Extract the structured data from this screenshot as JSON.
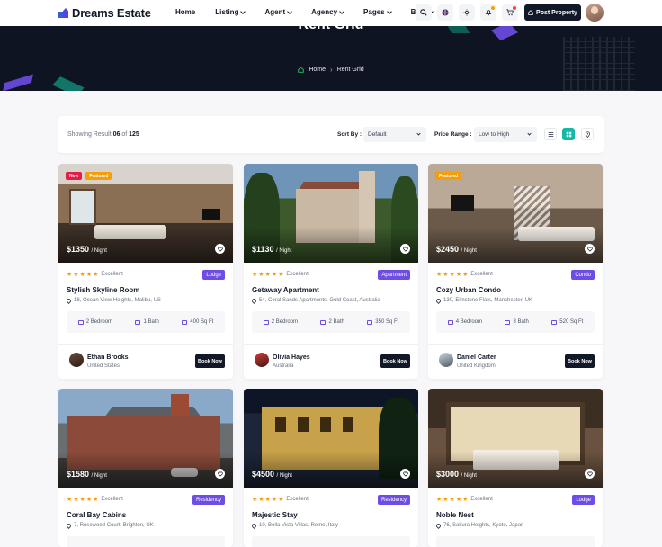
{
  "header": {
    "brand": "Dreams Estate",
    "nav": [
      {
        "label": "Home",
        "has_dropdown": false
      },
      {
        "label": "Listing",
        "has_dropdown": true
      },
      {
        "label": "Agent",
        "has_dropdown": true
      },
      {
        "label": "Agency",
        "has_dropdown": true
      },
      {
        "label": "Pages",
        "has_dropdown": true
      },
      {
        "label": "Blog",
        "has_dropdown": true
      }
    ],
    "icons": [
      "search-icon",
      "language-flag-icon",
      "theme-sun-icon",
      "notification-bell-icon",
      "cart-icon"
    ],
    "post_button": "Post Property"
  },
  "banner": {
    "title": "Rent Grid",
    "breadcrumb": [
      "Home",
      "Rent Grid"
    ]
  },
  "filter": {
    "showing_prefix": "Showing Result",
    "showing_count": "06",
    "showing_of": "of",
    "showing_total": "125",
    "sort_label": "Sort By :",
    "sort_value": "Default",
    "price_label": "Price Range :",
    "price_value": "Low to High",
    "views": [
      "list-view-icon",
      "grid-view-icon",
      "map-view-icon"
    ]
  },
  "colors": {
    "accent_purple": "#6d4de6",
    "accent_teal": "#14b8a6",
    "dark": "#111827",
    "star": "#f59e0b",
    "new_badge": "#e11d48",
    "featured_badge": "#f59e0b"
  },
  "listings": [
    {
      "badges": [
        "New",
        "Featured"
      ],
      "price": "$1350",
      "per": "/ Night",
      "rating_label": "Excellent",
      "stars": 5,
      "type": "Lodge",
      "title": "Stylish Skyline Room",
      "address": "18, Ocean View Heights, Malibu, US",
      "bedrooms": "2 Bedroom",
      "baths": "1 Bath",
      "area": "400 Sq Ft",
      "agent": "Ethan Brooks",
      "agent_loc": "United States",
      "book": "Book Now"
    },
    {
      "badges": [],
      "price": "$1130",
      "per": "/ Night",
      "rating_label": "Excellent",
      "stars": 5,
      "type": "Apartment",
      "title": "Getaway Apartment",
      "address": "54, Coral Sands Apartments, Gold Coast, Australia",
      "bedrooms": "2 Bedroom",
      "baths": "2 Bath",
      "area": "350 Sq Ft",
      "agent": "Olivia Hayes",
      "agent_loc": "Australia",
      "book": "Book Now"
    },
    {
      "badges": [
        "Featured"
      ],
      "price": "$2450",
      "per": "/ Night",
      "rating_label": "Excellent",
      "stars": 5,
      "type": "Condo",
      "title": "Cozy Urban Condo",
      "address": "130, Elmstone Flats, Manchester, UK",
      "bedrooms": "4 Bedroom",
      "baths": "3 Bath",
      "area": "520 Sq Ft",
      "agent": "Daniel Carter",
      "agent_loc": "United Kingdom",
      "book": "Book Now"
    },
    {
      "badges": [],
      "price": "$1580",
      "per": "/ Night",
      "rating_label": "Excellent",
      "stars": 5,
      "type": "Residency",
      "title": "Coral Bay Cabins",
      "address": "7, Rosewood Court, Brighton, UK"
    },
    {
      "badges": [],
      "price": "$4500",
      "per": "/ Night",
      "rating_label": "Excellent",
      "stars": 5,
      "type": "Residency",
      "title": "Majestic Stay",
      "address": "10, Bella Vista Villas, Rome, Italy"
    },
    {
      "badges": [],
      "price": "$3000",
      "per": "/ Night",
      "rating_label": "Excellent",
      "stars": 5,
      "type": "Lodge",
      "title": "Noble Nest",
      "address": "76, Sakura Heights, Kyoto, Japan"
    }
  ]
}
